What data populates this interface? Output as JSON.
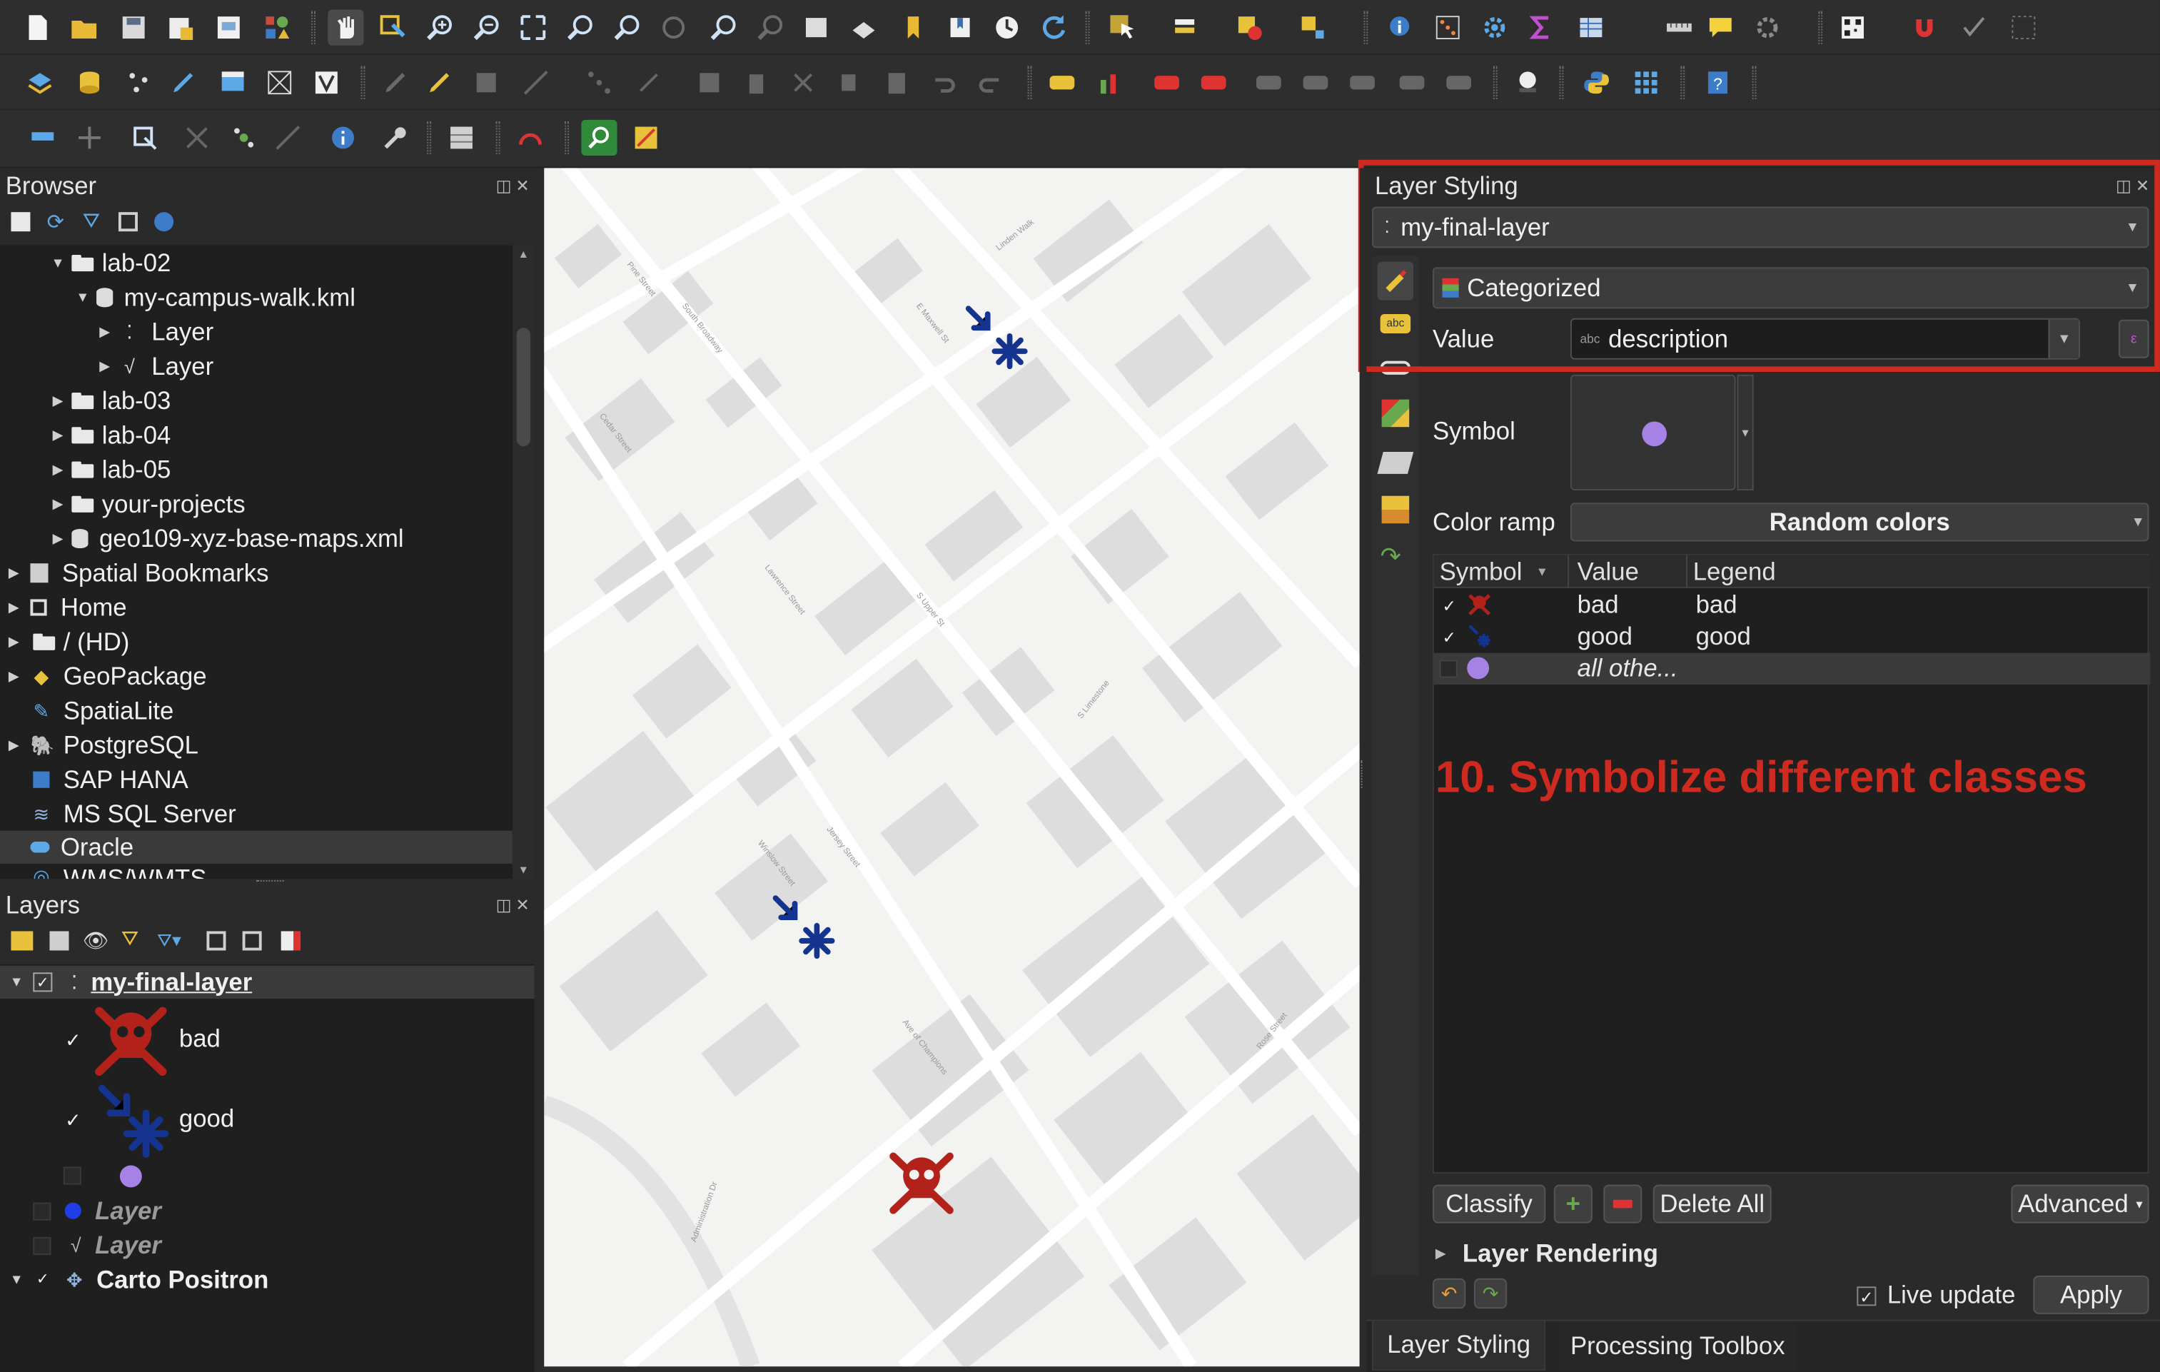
{
  "browser": {
    "title": "Browser",
    "items": [
      {
        "label": "lab-02"
      },
      {
        "label": "my-campus-walk.kml"
      },
      {
        "label": "Layer"
      },
      {
        "label": "Layer"
      },
      {
        "label": "lab-03"
      },
      {
        "label": "lab-04"
      },
      {
        "label": "lab-05"
      },
      {
        "label": "your-projects"
      },
      {
        "label": "geo109-xyz-base-maps.xml"
      },
      {
        "label": "Spatial Bookmarks"
      },
      {
        "label": "Home"
      },
      {
        "label": "/ (HD)"
      },
      {
        "label": "GeoPackage"
      },
      {
        "label": "SpatiaLite"
      },
      {
        "label": "PostgreSQL"
      },
      {
        "label": "SAP HANA"
      },
      {
        "label": "MS SQL Server"
      },
      {
        "label": "Oracle"
      },
      {
        "label": "WMS/WMTS"
      }
    ]
  },
  "layers": {
    "title": "Layers",
    "items": [
      {
        "label": "my-final-layer"
      },
      {
        "label": "bad"
      },
      {
        "label": "good"
      },
      {
        "label": "Layer"
      },
      {
        "label": "Layer"
      },
      {
        "label": "Carto Positron"
      }
    ]
  },
  "styling": {
    "title": "Layer Styling",
    "layer_select": "my-final-layer",
    "renderer": "Categorized",
    "value_label": "Value",
    "value_field": "description",
    "symbol_label": "Symbol",
    "color_ramp_label": "Color ramp",
    "color_ramp_value": "Random colors",
    "table": {
      "headers": [
        "Symbol",
        "Value",
        "Legend"
      ],
      "rows": [
        {
          "value": "bad",
          "legend": "bad",
          "checked": true,
          "color": "#b3221a"
        },
        {
          "value": "good",
          "legend": "good",
          "checked": true,
          "color": "#14348f"
        },
        {
          "value": "all othe...",
          "legend": "",
          "checked": false,
          "color": "#a782e6"
        }
      ]
    },
    "annotation": "10. Symbolize different classes",
    "buttons": {
      "classify": "Classify",
      "delete_all": "Delete All",
      "advanced": "Advanced"
    },
    "layer_rendering": "Layer Rendering",
    "live_update": "Live update",
    "apply": "Apply",
    "tabs": [
      "Layer Styling",
      "Processing Toolbox"
    ]
  },
  "map": {
    "streets": [
      "Pine Street",
      "South Broadway",
      "Cedar Street",
      "Lawrence Street",
      "E Maxwell St",
      "Linden Walk",
      "Jersey Street",
      "S Upper St",
      "Ave of Champions",
      "S Limestone",
      "Rose Street",
      "Winslow Street",
      "Administration Dr"
    ]
  },
  "colors": {
    "accent_red": "#cf2a1f",
    "bad_symbol": "#b3221a",
    "good_symbol": "#14348f",
    "other_symbol": "#a782e6"
  }
}
